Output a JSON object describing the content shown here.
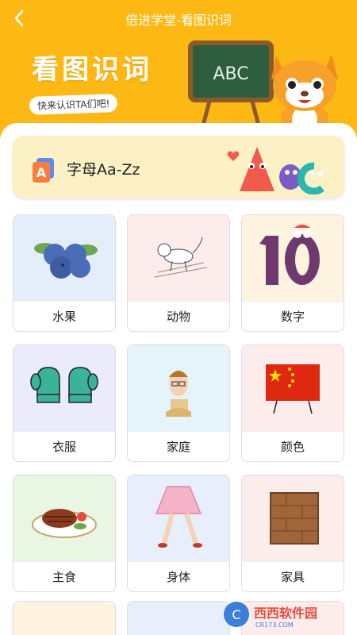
{
  "header": {
    "back_icon": "chevron-left-icon",
    "title": "倍进学堂-看图识词",
    "hero_title": "看图识词",
    "hero_subtitle": "快来认识TA们吧!",
    "board_text": "ABC"
  },
  "letter_banner": {
    "icon": "letter-a-icon",
    "label": "字母Aa-Zz"
  },
  "categories": [
    {
      "label": "水果",
      "icon": "blueberry-icon",
      "bg": "#E4EEFB"
    },
    {
      "label": "动物",
      "icon": "dog-icon",
      "bg": "#FDECEC"
    },
    {
      "label": "数字",
      "icon": "number-ten-icon",
      "bg": "#FDF3DF"
    },
    {
      "label": "衣服",
      "icon": "mittens-icon",
      "bg": "#ECEBFB"
    },
    {
      "label": "家庭",
      "icon": "person-icon",
      "bg": "#E5F4FB"
    },
    {
      "label": "颜色",
      "icon": "flag-icon",
      "bg": "#FDECEC"
    },
    {
      "label": "主食",
      "icon": "steak-icon",
      "bg": "#EAF6E4"
    },
    {
      "label": "身体",
      "icon": "skirt-legs-icon",
      "bg": "#E8EEFB"
    },
    {
      "label": "家具",
      "icon": "wooden-panel-icon",
      "bg": "#FDECEC"
    }
  ],
  "watermark": {
    "brand": "西西软件园",
    "site": "CR173.COM"
  },
  "colors": {
    "accent": "#FDB813",
    "banner_bg": "#FBF1C4"
  }
}
